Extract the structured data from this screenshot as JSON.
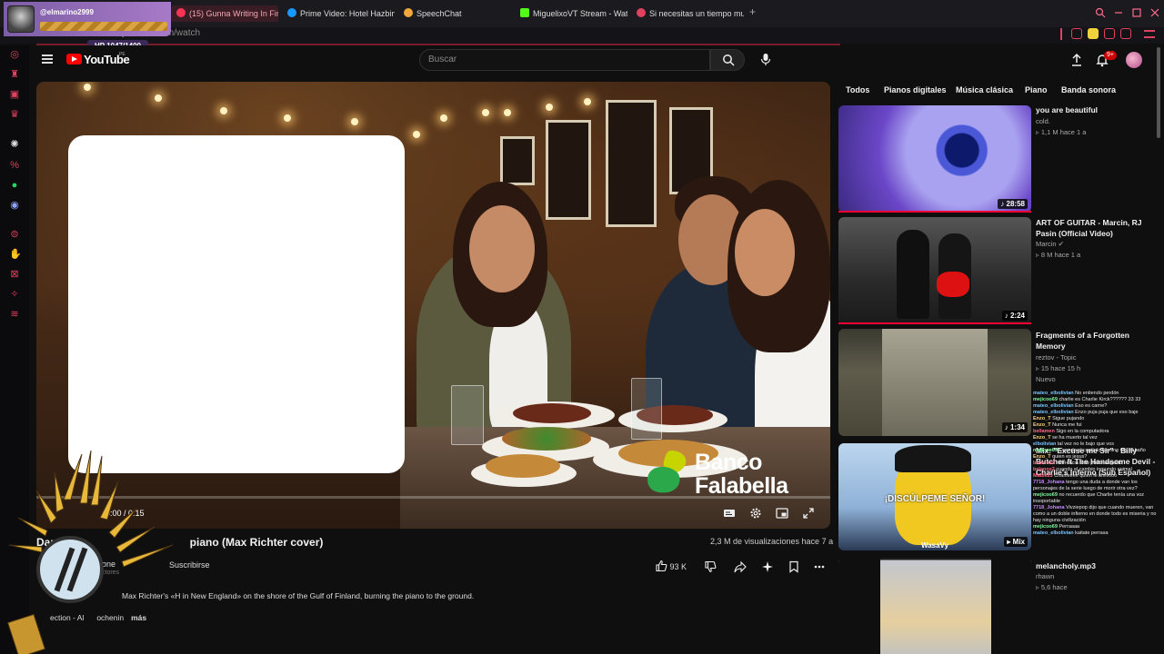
{
  "browser": {
    "tabs": [
      {
        "label": "(15) Gunna Writing In Fire",
        "active": true
      },
      {
        "label": "Prime Video: Hotel Hazbin",
        "active": false
      },
      {
        "label": "SpeechChat",
        "active": false
      },
      {
        "label": "MiguelixoVT Stream - Wat",
        "active": false
      },
      {
        "label": "Si necesitas un tiempo mue",
        "active": false
      }
    ],
    "new_tab": "+",
    "url": "www.youtube.com/watch"
  },
  "overlay": {
    "username": "@elmarino2999",
    "hp": "HP 1047/1400"
  },
  "youtube": {
    "logo": "YouTube",
    "logo_region": "PE",
    "search_placeholder": "Buscar",
    "notifications": "9+"
  },
  "video": {
    "time": "0:00 / 0:15",
    "ad_brand": "Banco\nFalabella",
    "title_start": "Dan",
    "title_end": "piano (Max Richter cover)",
    "channel": "ione",
    "subscribers": "ctores",
    "subscribe": "Suscribirse",
    "views_date": "2,3 M de visualizaciones  hace 7 a",
    "likes": "93 K",
    "description": "Max Richter's «H in New England» on the shore of the Gulf of Finland, burning the piano to the ground.",
    "description2_start": "ection - Al",
    "description2_mid": "ochenin",
    "more": "más"
  },
  "chips": [
    "Todos",
    "Pianos digitales",
    "Música clásica",
    "Piano",
    "Banda sonora"
  ],
  "recommendations": [
    {
      "title": "you are beautiful",
      "channel": "cold.",
      "meta": "1,1 M  hace 1 a",
      "duration": "28:58"
    },
    {
      "title": "ART OF GUITAR - Marcin, RJ Pasin (Official Video)",
      "channel": "Marcin",
      "meta": "8 M  hace 1 a",
      "duration": "2:24"
    },
    {
      "title": "Fragments of a Forgotten Memory",
      "channel": "reztov - Topic",
      "meta": "15  hace 15 h",
      "badge": "Nuevo",
      "duration": "1:34"
    },
    {
      "title": "Mix: \"Excuse me Sir\" - Billy Butcher ft The Handsome Devil - Charlie's Inferno (Sub Español)",
      "channel": "",
      "meta": "",
      "duration": "Mix",
      "caption": "¡DISCÚLPEME SEÑOR!",
      "watermark": "WasaVy"
    },
    {
      "title": "melancholy.mp3",
      "channel": "rhawn",
      "meta": "5,6  hace",
      "duration": ""
    }
  ],
  "chat": [
    {
      "user": "mateo_elbolivian",
      "msg": "No entiendo perdón"
    },
    {
      "user": "mejicoo69",
      "msg": "charlie es Charlie Kirck?????? 33 33"
    },
    {
      "user": "mateo_elbolivian",
      "msg": "Eso es carne?"
    },
    {
      "user": "mateo_elbolivian",
      "msg": "Enzo puja puja que eso baje"
    },
    {
      "user": "Enzo_T",
      "msg": "Sigue pujando"
    },
    {
      "user": "Enzo_T",
      "msg": "Nunca me fui"
    },
    {
      "user": "bellamen",
      "msg": "Sigo en la computadora"
    },
    {
      "user": "Enzo_T",
      "msg": "se ha muerto tal vez"
    },
    {
      "user": "elbolivian",
      "msg": "tal vez no le bajo que vos"
    },
    {
      "user": "mejicoo69",
      "msg": "Cuando el capítulo termine voy al baño"
    },
    {
      "user": "Enzo_T",
      "msg": "quien es jesus?"
    },
    {
      "user": "belanos2",
      "msg": "referencia a mi pobre angelito"
    },
    {
      "user": "belanos2",
      "msg": "cuando el cambio inmundo animal"
    },
    {
      "user": "Madik23",
      "msg": "Charlieeee quien le invivooo"
    },
    {
      "user": "7718_Johana",
      "msg": "tengo una duda a donde van los personajes de la serie luego de morir otra vez?"
    },
    {
      "user": "mejicoo69",
      "msg": "no recuerdo que Charlie tenía una voz insoportable"
    },
    {
      "user": "7718_Johana",
      "msg": "Vivziepop dijo que cuando mueren, van como a un doble infierno en donde todo es miseria y no hay ninguna civilización"
    },
    {
      "user": "mejicoo69",
      "msg": "Perraaaa"
    },
    {
      "user": "mateo_elbolivian",
      "msg": "kaitate perrasa"
    }
  ]
}
